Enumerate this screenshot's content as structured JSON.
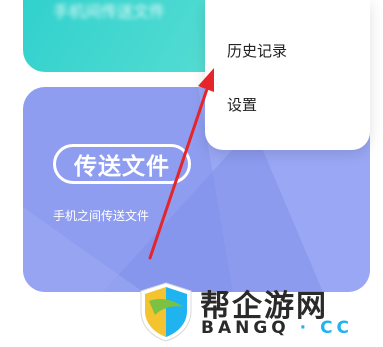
{
  "top_card": {
    "text": "手机间传送文件"
  },
  "transfer_card": {
    "title": "传送文件",
    "description": "手机之间传送文件"
  },
  "menu": {
    "items": [
      {
        "label": "历史记录"
      },
      {
        "label": "设置"
      }
    ]
  },
  "watermark": {
    "name": "帮企游网",
    "domain_prefix": "BANGQ",
    "domain_sep": "·",
    "domain_suffix": "CC"
  },
  "colors": {
    "teal": "#2ed0cc",
    "purple": "#8f9df0",
    "arrow": "#e5252a",
    "watermark_blue": "#1fb3ef"
  }
}
